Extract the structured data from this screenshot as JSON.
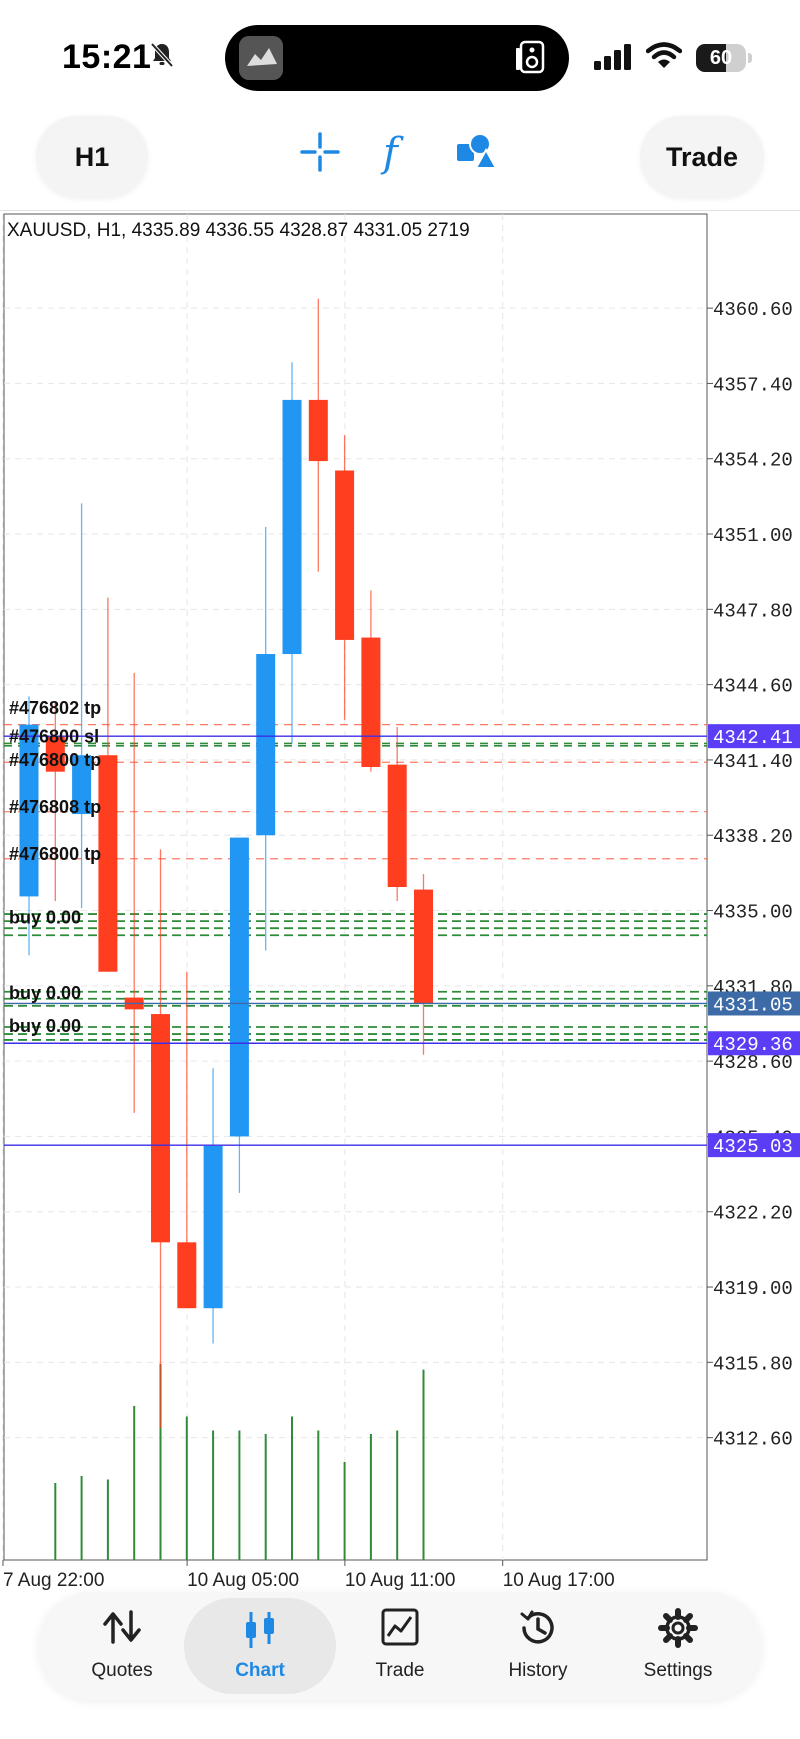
{
  "status_bar": {
    "time": "15:21",
    "battery": "60",
    "battery_level": 0.6
  },
  "toolbar": {
    "timeframe": "H1",
    "trade_label": "Trade",
    "function_glyph": "f"
  },
  "chart_data": {
    "type": "candlestick",
    "title": "XAUUSD, H1, 4335.89 4336.55 4328.87 4331.05 2719",
    "ylim": [
      4307.4,
      4364.6
    ],
    "y_ticks": [
      "4360.60",
      "4357.40",
      "4354.20",
      "4351.00",
      "4347.80",
      "4344.60",
      "4341.40",
      "4338.20",
      "4335.00",
      "4331.80",
      "4328.60",
      "4325.40",
      "4322.20",
      "4319.00",
      "4315.80",
      "4312.60"
    ],
    "x_labels": [
      {
        "label": "7 Aug 22:00",
        "idx": 0
      },
      {
        "label": "10 Aug 05:00",
        "idx": 7
      },
      {
        "label": "10 Aug 11:00",
        "idx": 13
      },
      {
        "label": "10 Aug 17:00",
        "idx": 19
      }
    ],
    "candles": [
      {
        "o": 4335.6,
        "h": 4344.1,
        "l": 4333.1,
        "c": 4342.9,
        "v": 0
      },
      {
        "o": 4342.4,
        "h": 4343.9,
        "l": 4335.4,
        "c": 4340.9,
        "v": 1100
      },
      {
        "o": 4339.1,
        "h": 4352.3,
        "l": 4335.1,
        "c": 4341.6,
        "v": 1200
      },
      {
        "o": 4341.6,
        "h": 4348.3,
        "l": 4333.4,
        "c": 4332.4,
        "v": 1150
      },
      {
        "o": 4331.3,
        "h": 4345.1,
        "l": 4326.4,
        "c": 4330.8,
        "v": 2200
      },
      {
        "o": 4330.6,
        "h": 4337.6,
        "l": 4313.0,
        "c": 4320.9,
        "v": 2800
      },
      {
        "o": 4320.9,
        "h": 4332.4,
        "l": 4318.8,
        "c": 4318.1,
        "v": 2050
      },
      {
        "o": 4318.1,
        "h": 4328.3,
        "l": 4316.6,
        "c": 4325.0,
        "v": 1850
      },
      {
        "o": 4325.4,
        "h": 4328.4,
        "l": 4323.0,
        "c": 4338.1,
        "v": 1850
      },
      {
        "o": 4338.2,
        "h": 4351.3,
        "l": 4333.3,
        "c": 4345.9,
        "v": 1800
      },
      {
        "o": 4345.9,
        "h": 4358.3,
        "l": 4342.1,
        "c": 4356.7,
        "v": 2050
      },
      {
        "o": 4356.7,
        "h": 4361.0,
        "l": 4349.4,
        "c": 4354.1,
        "v": 1850
      },
      {
        "o": 4353.7,
        "h": 4355.2,
        "l": 4343.1,
        "c": 4346.5,
        "v": 1400
      },
      {
        "o": 4346.6,
        "h": 4348.6,
        "l": 4340.9,
        "c": 4341.1,
        "v": 1800
      },
      {
        "o": 4341.2,
        "h": 4342.8,
        "l": 4335.4,
        "c": 4336.0,
        "v": 1850
      },
      {
        "o": 4335.89,
        "h": 4336.55,
        "l": 4328.87,
        "c": 4331.05,
        "v": 2719
      }
    ],
    "tp_levels": [
      4342.9,
      4341.3,
      4339.2,
      4337.2
    ],
    "sl_levels": [
      4342.1,
      4342.0
    ],
    "buy_levels": [
      4334.85,
      4334.55,
      4334.25,
      4333.95,
      4331.55,
      4331.25,
      4330.95,
      4330.05,
      4329.75,
      4329.5
    ],
    "order_labels": [
      {
        "text": "#476802 tp",
        "price": 4343.6
      },
      {
        "text": "#476800 sl",
        "price": 4342.4
      },
      {
        "text": "#476800 tp",
        "price": 4341.4
      },
      {
        "text": "#476808 tp",
        "price": 4339.4
      },
      {
        "text": "#476800 tp",
        "price": 4337.4
      },
      {
        "text": "buy 0.00",
        "price": 4334.7
      },
      {
        "text": "buy 0.00",
        "price": 4331.5
      },
      {
        "text": "buy 0.00",
        "price": 4330.1
      }
    ],
    "price_badges": [
      {
        "label": "4342.41",
        "price": 4342.41,
        "color": "#5b3df5"
      },
      {
        "label": "4331.05",
        "price": 4331.05,
        "color": "#3d6ba8"
      },
      {
        "label": "4329.36",
        "price": 4329.36,
        "color": "#5b3df5"
      },
      {
        "label": "4325.03",
        "price": 4325.03,
        "color": "#5b3df5"
      }
    ],
    "colors": {
      "bull": "#2196f3",
      "bear": "#ff3d1f",
      "volume": "#2e8b3a",
      "tp": "#ff5a3c",
      "buy": "#2e8b3a",
      "hline": "#3b2ee8"
    }
  },
  "nav": [
    {
      "label": "Quotes",
      "icon": "quotes-icon"
    },
    {
      "label": "Chart",
      "icon": "chart-icon"
    },
    {
      "label": "Trade",
      "icon": "trade-icon"
    },
    {
      "label": "History",
      "icon": "history-icon"
    },
    {
      "label": "Settings",
      "icon": "gear-icon"
    }
  ]
}
